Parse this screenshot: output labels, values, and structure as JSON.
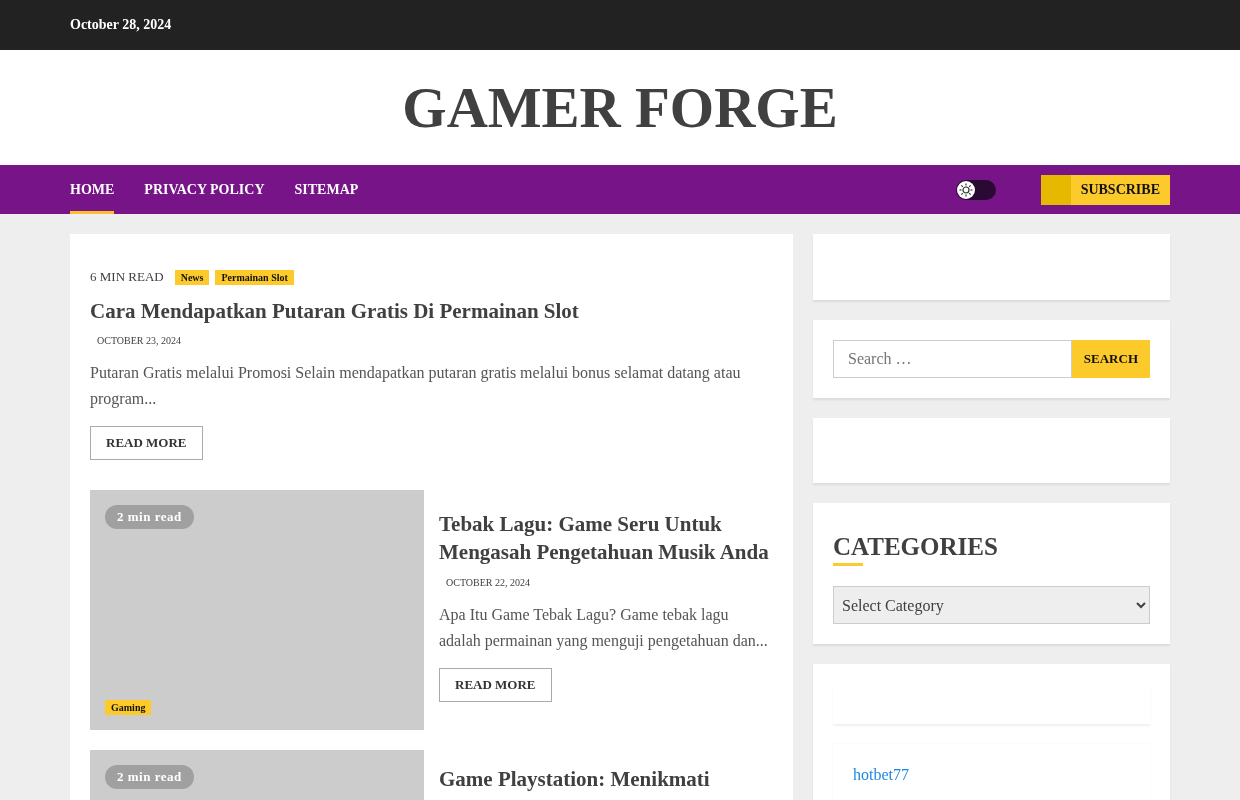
{
  "top_bar": {
    "date": "October 28, 2024"
  },
  "site": {
    "title": "GAMER FORGE"
  },
  "nav": {
    "items": [
      {
        "label": "HOME",
        "selected": true
      },
      {
        "label": "PRIVACY POLICY",
        "selected": false
      },
      {
        "label": "SITEMAP",
        "selected": false
      }
    ],
    "dark_mode": false,
    "subscribe": "SUBSCRIBE"
  },
  "featured": {
    "read_time": "6 MIN READ",
    "tags": [
      "News",
      "Permainan Slot"
    ],
    "title": "Cara Mendapatkan Putaran Gratis Di Permainan Slot",
    "date": "OCTOBER 23, 2024",
    "excerpt": "Putaran Gratis melalui Promosi Selain mendapatkan putaran gratis melalui bonus selamat datang atau program...",
    "button": "READ MORE"
  },
  "posts": [
    {
      "read_time": "2 min read",
      "tag": "Gaming",
      "title": "Tebak Lagu: Game Seru Untuk Mengasah Pengetahuan Musik Anda",
      "date": "OCTOBER 22, 2024",
      "excerpt": "Apa Itu Game Tebak Lagu? Game tebak lagu adalah permainan yang menguji pengetahuan dan...",
      "button": "READ MORE"
    },
    {
      "read_time": "2 min read",
      "title": "Game Playstation: Menikmati"
    }
  ],
  "sidebar": {
    "search": {
      "placeholder": "Search …",
      "button": "SEARCH"
    },
    "categories": {
      "title": "CATEGORIES",
      "select": "Select Category"
    },
    "links": [
      "hotbet77"
    ]
  }
}
